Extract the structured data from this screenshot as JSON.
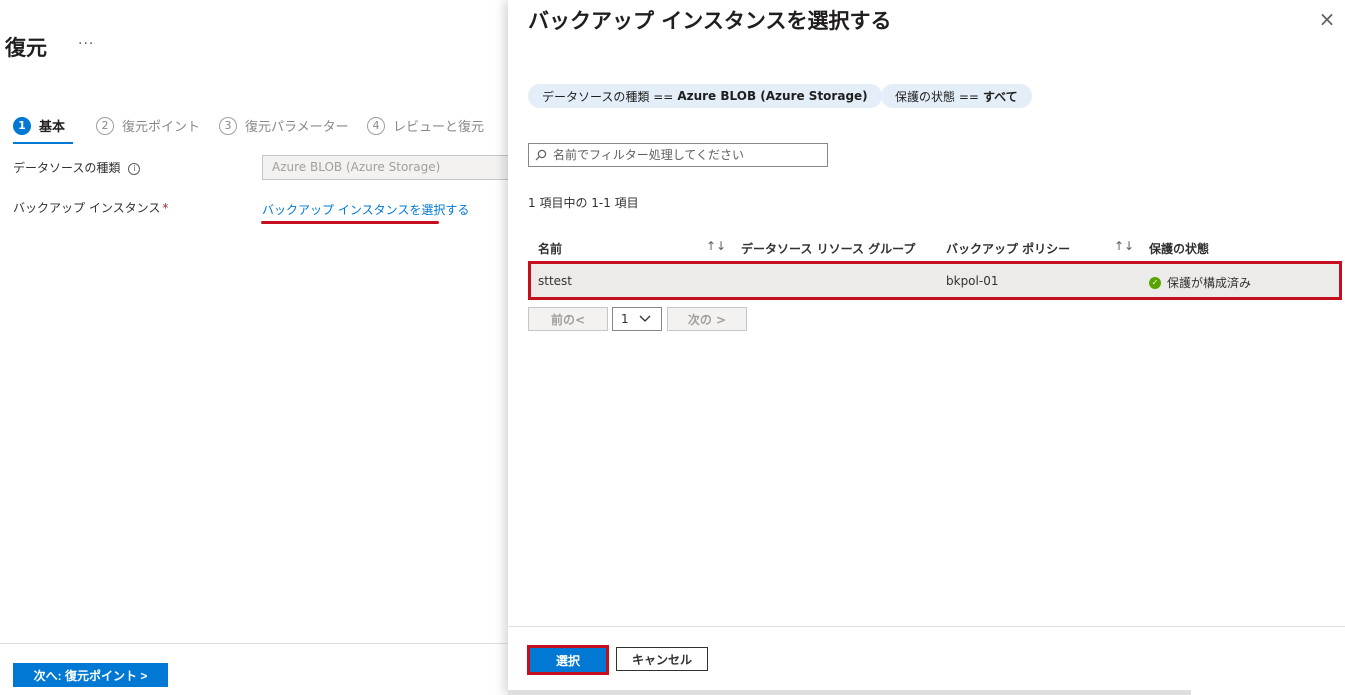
{
  "left": {
    "title": "復元",
    "more": "···",
    "steps": [
      {
        "num": "1",
        "label": "基本"
      },
      {
        "num": "2",
        "label": "復元ポイント"
      },
      {
        "num": "3",
        "label": "復元パラメーター"
      },
      {
        "num": "4",
        "label": "レビューと復元"
      }
    ],
    "datasource_label": "データソースの種類",
    "datasource_value": "Azure BLOB (Azure Storage)",
    "instance_label": "バックアップ インスタンス",
    "required_mark": "*",
    "select_link": "バックアップ インスタンスを選択する",
    "next_button": "次へ: 復元ポイント >"
  },
  "panel": {
    "title": "バックアップ インスタンスを選択する",
    "close": "×",
    "filters": [
      {
        "key": "データソースの種類 ==",
        "value": "Azure BLOB (Azure Storage)"
      },
      {
        "key": "保護の状態 ==",
        "value": "すべて"
      }
    ],
    "search_placeholder": "名前でフィルター処理してください",
    "count_text": "1 項目中の 1-1 項目",
    "columns": [
      "名前",
      "データソース リソース グループ",
      "バックアップ ポリシー",
      "保護の状態"
    ],
    "sort_glyph": "↑↓",
    "rows": [
      {
        "name": "sttest",
        "resource_group": "",
        "policy": "bkpol-01",
        "status": "保護が構成済み"
      }
    ],
    "pager": {
      "prev": "前の<",
      "page": "1",
      "next": "次の >"
    },
    "select_button": "選択",
    "cancel_button": "キャンセル"
  },
  "colors": {
    "accent": "#0078d4",
    "highlight": "#c50f1f",
    "success": "#57a300"
  }
}
